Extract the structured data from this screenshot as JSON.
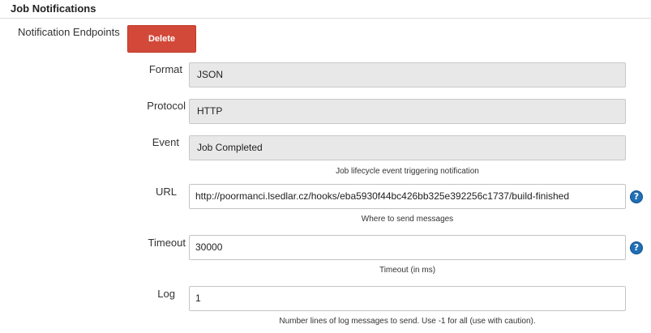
{
  "section": {
    "title": "Job Notifications"
  },
  "endpoints": {
    "label": "Notification Endpoints",
    "delete_label": "Delete"
  },
  "fields": {
    "format": {
      "label": "Format",
      "value": "JSON"
    },
    "protocol": {
      "label": "Protocol",
      "value": "HTTP"
    },
    "event": {
      "label": "Event",
      "value": "Job Completed",
      "help": "Job lifecycle event triggering notification"
    },
    "url": {
      "label": "URL",
      "value": "http://poormanci.lsedlar.cz/hooks/eba5930f44bc426bb325e392256c1737/build-finished",
      "help": "Where to send messages"
    },
    "timeout": {
      "label": "Timeout",
      "value": "30000",
      "help": "Timeout (in ms)"
    },
    "log": {
      "label": "Log",
      "value": "1",
      "help": "Number lines of log messages to send. Use -1 for all (use with caution)."
    }
  },
  "icons": {
    "help": "help-icon",
    "help_glyph": "?"
  },
  "colors": {
    "delete_button": "#d24939",
    "help_icon": "#1f6fb5",
    "readonly_field": "#e8e8e8"
  }
}
